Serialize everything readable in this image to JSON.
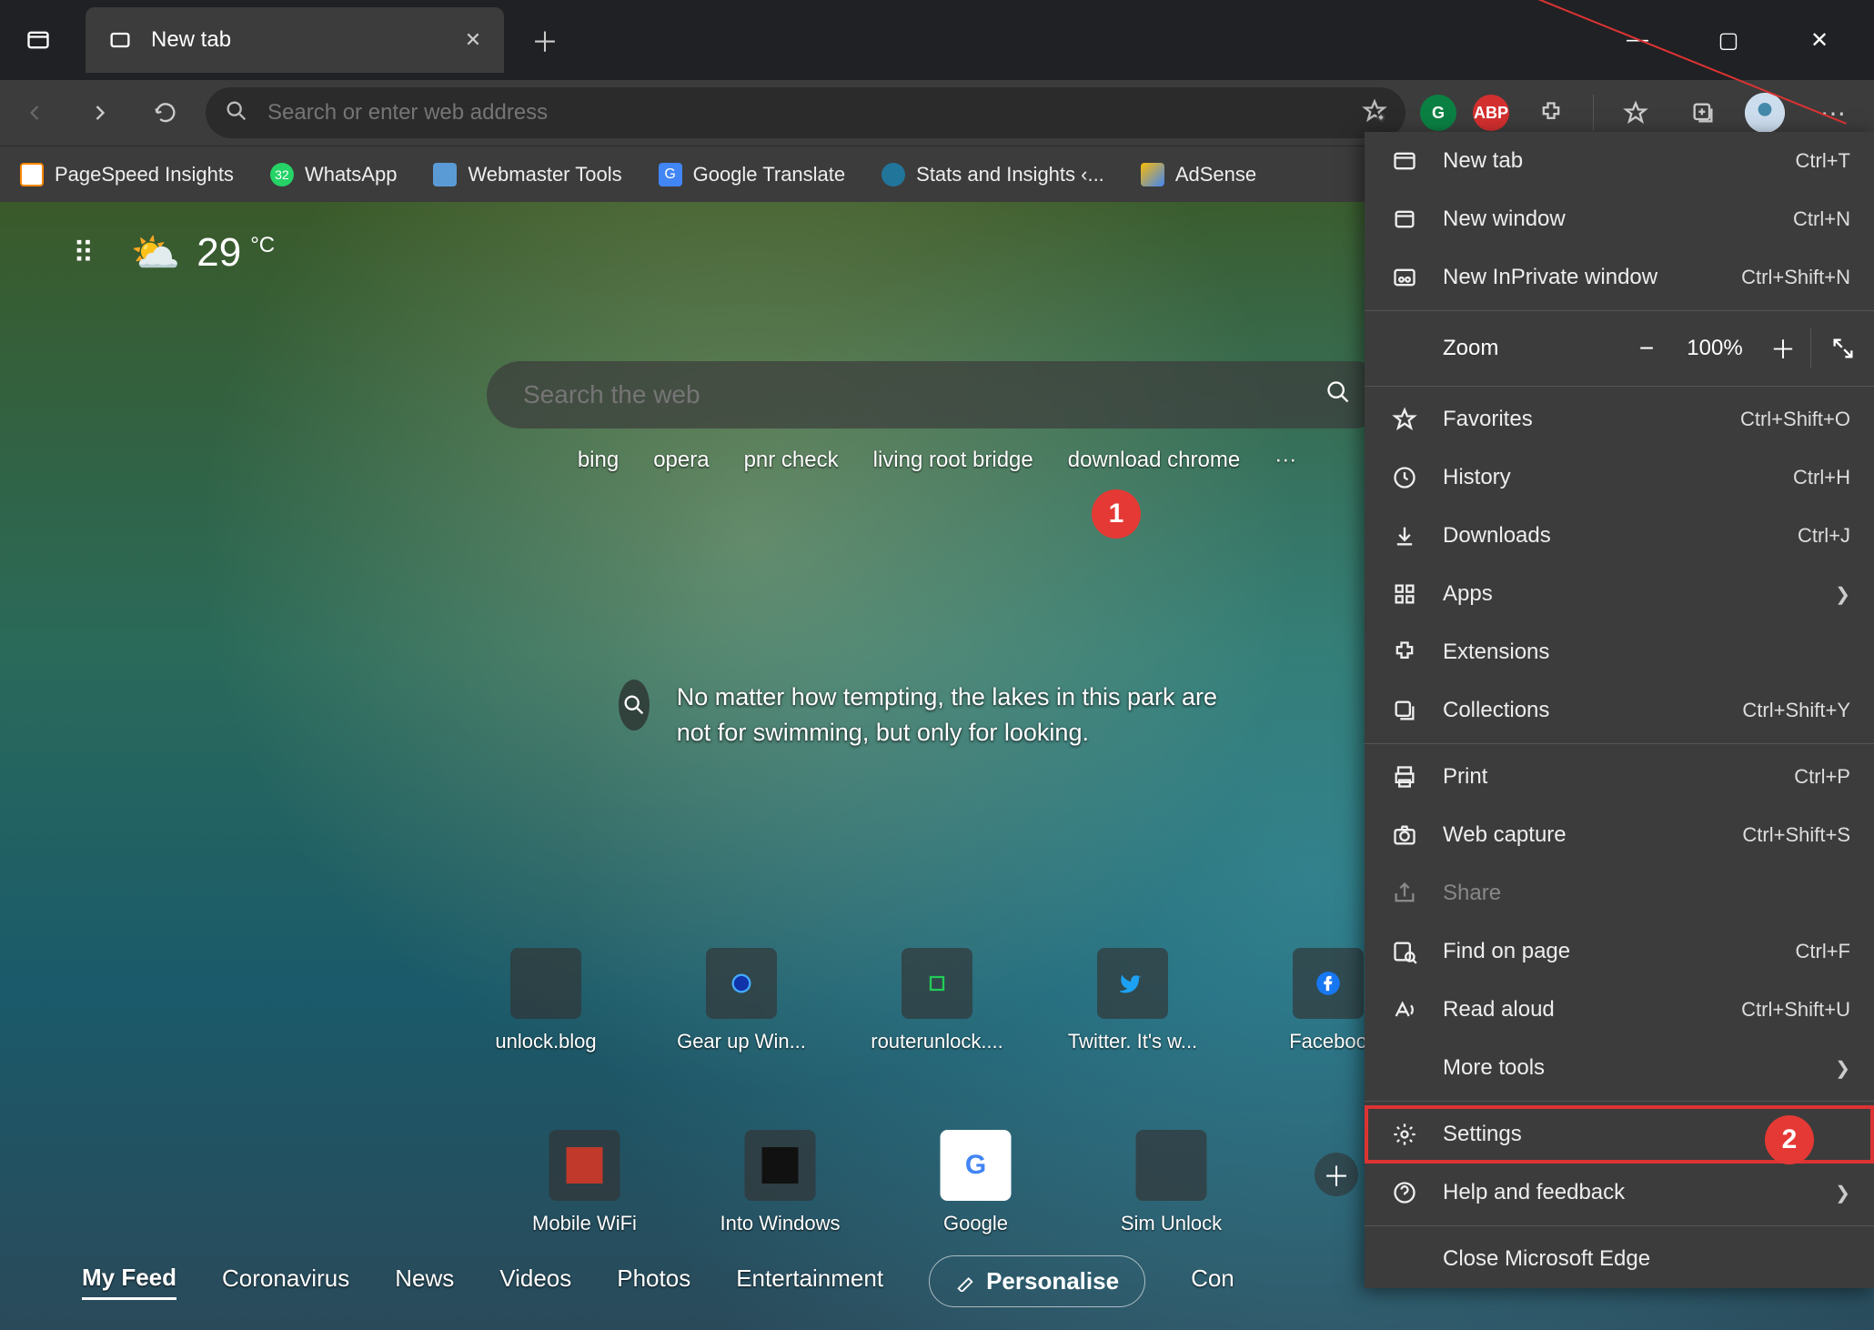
{
  "tab": {
    "title": "New tab"
  },
  "omnibox": {
    "placeholder": "Search or enter web address"
  },
  "bookmarks": [
    {
      "label": "PageSpeed Insights",
      "color": "#4285f4"
    },
    {
      "label": "WhatsApp",
      "color": "#25d366"
    },
    {
      "label": "Webmaster Tools",
      "color": "#5b9bd5"
    },
    {
      "label": "Google Translate",
      "color": "#4285f4"
    },
    {
      "label": "Stats and Insights ‹...",
      "color": "#21759b"
    },
    {
      "label": "AdSense",
      "color": "#fbbc05"
    }
  ],
  "weather": {
    "temp": "29",
    "unit": "°C"
  },
  "ntp_search": {
    "placeholder": "Search the web"
  },
  "suggestions": [
    "bing",
    "opera",
    "pnr check",
    "living root bridge",
    "download chrome",
    "···"
  ],
  "trivia": "No matter how tempting, the lakes in this park are not for swimming, but only for looking.",
  "tiles_row1": [
    {
      "label": "unlock.blog",
      "bg": "#3a3a3a"
    },
    {
      "label": "Gear up Win...",
      "bg": "#3a3a3a"
    },
    {
      "label": "routerunlock....",
      "bg": "#3a3a3a"
    },
    {
      "label": "Twitter. It's w...",
      "bg": "#1da1f2"
    },
    {
      "label": "Faceboo",
      "bg": "#1877f2"
    }
  ],
  "tiles_row2": [
    {
      "label": "Mobile WiFi",
      "bg": "#c0392b"
    },
    {
      "label": "Into Windows",
      "bg": "#222"
    },
    {
      "label": "Google",
      "bg": "#fff"
    },
    {
      "label": "Sim Unlock",
      "bg": "#ddd"
    }
  ],
  "feed": {
    "links": [
      "My Feed",
      "Coronavirus",
      "News",
      "Videos",
      "Photos",
      "Entertainment"
    ],
    "personalise": "Personalise",
    "extra": "Con"
  },
  "menu": {
    "new_tab": {
      "label": "New tab",
      "shortcut": "Ctrl+T"
    },
    "new_window": {
      "label": "New window",
      "shortcut": "Ctrl+N"
    },
    "new_inprivate": {
      "label": "New InPrivate window",
      "shortcut": "Ctrl+Shift+N"
    },
    "zoom": {
      "label": "Zoom",
      "value": "100%"
    },
    "favorites": {
      "label": "Favorites",
      "shortcut": "Ctrl+Shift+O"
    },
    "history": {
      "label": "History",
      "shortcut": "Ctrl+H"
    },
    "downloads": {
      "label": "Downloads",
      "shortcut": "Ctrl+J"
    },
    "apps": {
      "label": "Apps"
    },
    "extensions": {
      "label": "Extensions"
    },
    "collections": {
      "label": "Collections",
      "shortcut": "Ctrl+Shift+Y"
    },
    "print": {
      "label": "Print",
      "shortcut": "Ctrl+P"
    },
    "web_capture": {
      "label": "Web capture",
      "shortcut": "Ctrl+Shift+S"
    },
    "share": {
      "label": "Share"
    },
    "find": {
      "label": "Find on page",
      "shortcut": "Ctrl+F"
    },
    "read_aloud": {
      "label": "Read aloud",
      "shortcut": "Ctrl+Shift+U"
    },
    "more_tools": {
      "label": "More tools"
    },
    "settings": {
      "label": "Settings"
    },
    "help": {
      "label": "Help and feedback"
    },
    "close_edge": {
      "label": "Close Microsoft Edge"
    }
  },
  "annotations": {
    "badge1": "1",
    "badge2": "2"
  }
}
